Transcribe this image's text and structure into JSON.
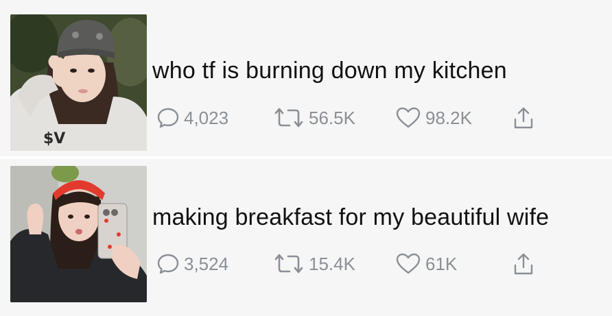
{
  "posts": [
    {
      "text": "who tf is burning down my kitchen",
      "replies": "4,023",
      "retweets": "56.5K",
      "likes": "98.2K",
      "photo": {
        "colors": {
          "bg": "#3f4a2e",
          "hat": "#5a5a58",
          "hoodie": "#e4e2df",
          "hair": "#3a2a22",
          "skin": "#efd3c3"
        }
      }
    },
    {
      "text": "making breakfast for my beautiful wife",
      "replies": "3,524",
      "retweets": "15.4K",
      "likes": "61K",
      "photo": {
        "colors": {
          "bg": "#cfcfcc",
          "headband": "#e23b2e",
          "jacket": "#26282c",
          "hair": "#2b1d18",
          "skin": "#f0d0c2",
          "phone": "#d9d3cf"
        }
      }
    }
  ],
  "icons": {
    "reply": "speech-bubble-icon",
    "retweet": "retweet-icon",
    "like": "heart-icon",
    "share": "share-icon"
  },
  "colors": {
    "text": "#111111",
    "muted": "#8a8f96",
    "background": "#f6f6f6"
  }
}
